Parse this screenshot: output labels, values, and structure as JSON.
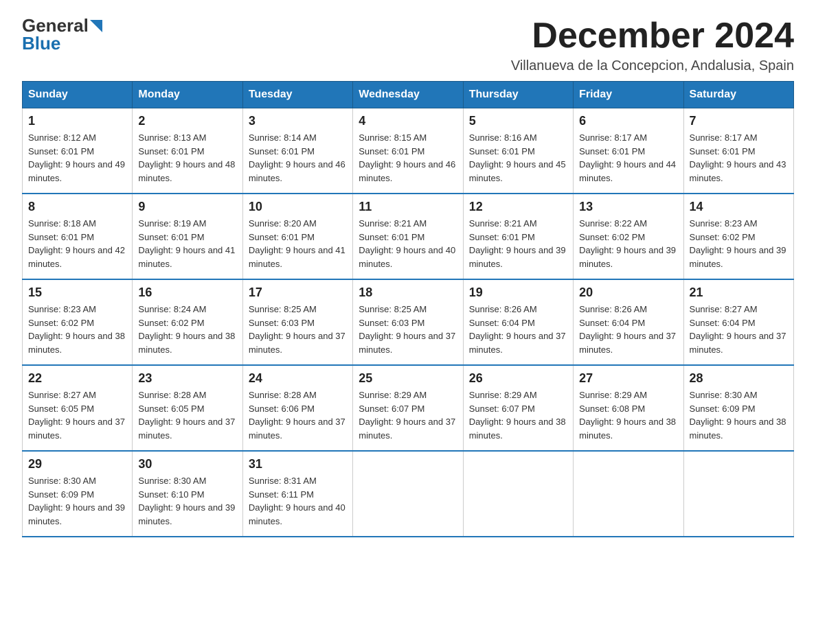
{
  "logo": {
    "general": "General",
    "blue": "Blue"
  },
  "title": "December 2024",
  "subtitle": "Villanueva de la Concepcion, Andalusia, Spain",
  "weekdays": [
    "Sunday",
    "Monday",
    "Tuesday",
    "Wednesday",
    "Thursday",
    "Friday",
    "Saturday"
  ],
  "weeks": [
    [
      {
        "day": "1",
        "sunrise": "8:12 AM",
        "sunset": "6:01 PM",
        "daylight": "9 hours and 49 minutes."
      },
      {
        "day": "2",
        "sunrise": "8:13 AM",
        "sunset": "6:01 PM",
        "daylight": "9 hours and 48 minutes."
      },
      {
        "day": "3",
        "sunrise": "8:14 AM",
        "sunset": "6:01 PM",
        "daylight": "9 hours and 46 minutes."
      },
      {
        "day": "4",
        "sunrise": "8:15 AM",
        "sunset": "6:01 PM",
        "daylight": "9 hours and 46 minutes."
      },
      {
        "day": "5",
        "sunrise": "8:16 AM",
        "sunset": "6:01 PM",
        "daylight": "9 hours and 45 minutes."
      },
      {
        "day": "6",
        "sunrise": "8:17 AM",
        "sunset": "6:01 PM",
        "daylight": "9 hours and 44 minutes."
      },
      {
        "day": "7",
        "sunrise": "8:17 AM",
        "sunset": "6:01 PM",
        "daylight": "9 hours and 43 minutes."
      }
    ],
    [
      {
        "day": "8",
        "sunrise": "8:18 AM",
        "sunset": "6:01 PM",
        "daylight": "9 hours and 42 minutes."
      },
      {
        "day": "9",
        "sunrise": "8:19 AM",
        "sunset": "6:01 PM",
        "daylight": "9 hours and 41 minutes."
      },
      {
        "day": "10",
        "sunrise": "8:20 AM",
        "sunset": "6:01 PM",
        "daylight": "9 hours and 41 minutes."
      },
      {
        "day": "11",
        "sunrise": "8:21 AM",
        "sunset": "6:01 PM",
        "daylight": "9 hours and 40 minutes."
      },
      {
        "day": "12",
        "sunrise": "8:21 AM",
        "sunset": "6:01 PM",
        "daylight": "9 hours and 39 minutes."
      },
      {
        "day": "13",
        "sunrise": "8:22 AM",
        "sunset": "6:02 PM",
        "daylight": "9 hours and 39 minutes."
      },
      {
        "day": "14",
        "sunrise": "8:23 AM",
        "sunset": "6:02 PM",
        "daylight": "9 hours and 39 minutes."
      }
    ],
    [
      {
        "day": "15",
        "sunrise": "8:23 AM",
        "sunset": "6:02 PM",
        "daylight": "9 hours and 38 minutes."
      },
      {
        "day": "16",
        "sunrise": "8:24 AM",
        "sunset": "6:02 PM",
        "daylight": "9 hours and 38 minutes."
      },
      {
        "day": "17",
        "sunrise": "8:25 AM",
        "sunset": "6:03 PM",
        "daylight": "9 hours and 37 minutes."
      },
      {
        "day": "18",
        "sunrise": "8:25 AM",
        "sunset": "6:03 PM",
        "daylight": "9 hours and 37 minutes."
      },
      {
        "day": "19",
        "sunrise": "8:26 AM",
        "sunset": "6:04 PM",
        "daylight": "9 hours and 37 minutes."
      },
      {
        "day": "20",
        "sunrise": "8:26 AM",
        "sunset": "6:04 PM",
        "daylight": "9 hours and 37 minutes."
      },
      {
        "day": "21",
        "sunrise": "8:27 AM",
        "sunset": "6:04 PM",
        "daylight": "9 hours and 37 minutes."
      }
    ],
    [
      {
        "day": "22",
        "sunrise": "8:27 AM",
        "sunset": "6:05 PM",
        "daylight": "9 hours and 37 minutes."
      },
      {
        "day": "23",
        "sunrise": "8:28 AM",
        "sunset": "6:05 PM",
        "daylight": "9 hours and 37 minutes."
      },
      {
        "day": "24",
        "sunrise": "8:28 AM",
        "sunset": "6:06 PM",
        "daylight": "9 hours and 37 minutes."
      },
      {
        "day": "25",
        "sunrise": "8:29 AM",
        "sunset": "6:07 PM",
        "daylight": "9 hours and 37 minutes."
      },
      {
        "day": "26",
        "sunrise": "8:29 AM",
        "sunset": "6:07 PM",
        "daylight": "9 hours and 38 minutes."
      },
      {
        "day": "27",
        "sunrise": "8:29 AM",
        "sunset": "6:08 PM",
        "daylight": "9 hours and 38 minutes."
      },
      {
        "day": "28",
        "sunrise": "8:30 AM",
        "sunset": "6:09 PM",
        "daylight": "9 hours and 38 minutes."
      }
    ],
    [
      {
        "day": "29",
        "sunrise": "8:30 AM",
        "sunset": "6:09 PM",
        "daylight": "9 hours and 39 minutes."
      },
      {
        "day": "30",
        "sunrise": "8:30 AM",
        "sunset": "6:10 PM",
        "daylight": "9 hours and 39 minutes."
      },
      {
        "day": "31",
        "sunrise": "8:31 AM",
        "sunset": "6:11 PM",
        "daylight": "9 hours and 40 minutes."
      },
      null,
      null,
      null,
      null
    ]
  ]
}
